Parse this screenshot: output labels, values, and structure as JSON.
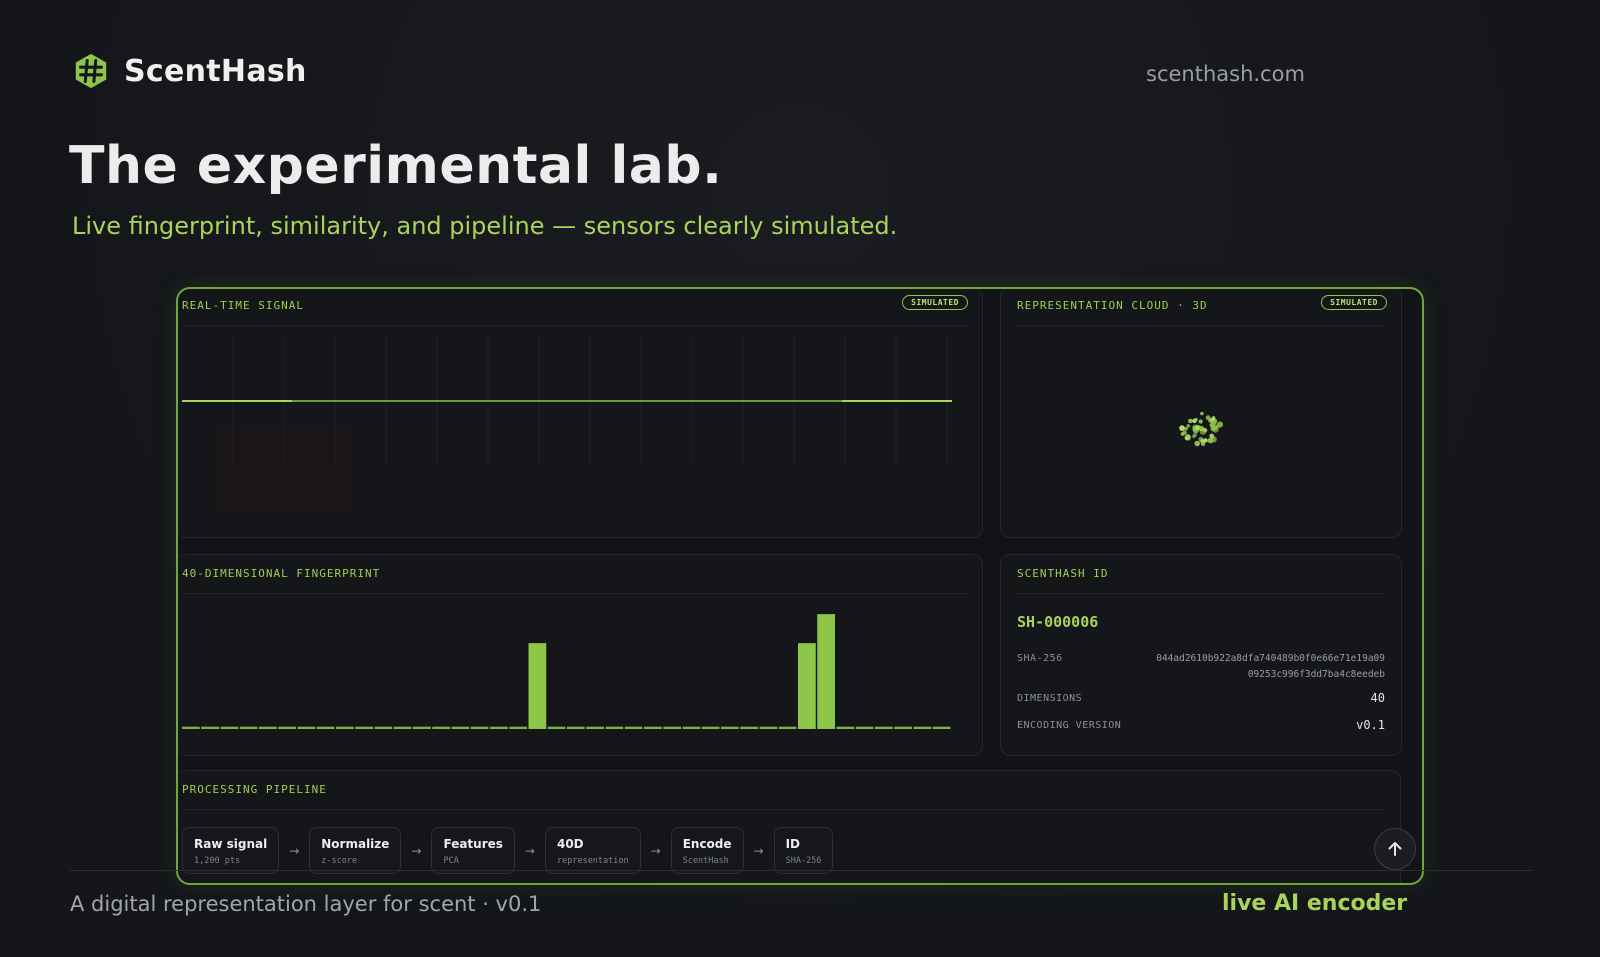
{
  "header": {
    "brand_name": "ScentHash",
    "logo_icon": "hash-hexagon-icon",
    "site_url": "scenthash.com"
  },
  "hero": {
    "title": "The experimental lab.",
    "subtitle": "Live fingerprint, similarity, and pipeline — sensors clearly simulated."
  },
  "theme": {
    "accent": "#a9d45a",
    "border": "#6fa83a",
    "background": "#141619"
  },
  "lab": {
    "signal_panel": {
      "title": "REAL-TIME SIGNAL",
      "badge": "SIMULATED"
    },
    "cloud_panel": {
      "title": "REPRESENTATION CLOUD · 3D",
      "badge": "SIMULATED"
    },
    "fingerprint_panel": {
      "title": "40-DIMENSIONAL FINGERPRINT",
      "values": [
        0.02,
        0.02,
        0.02,
        0.02,
        0.02,
        0.02,
        0.02,
        0.02,
        0.02,
        0.02,
        0.02,
        0.02,
        0.02,
        0.02,
        0.02,
        0.02,
        0.02,
        0.02,
        0.74,
        0.02,
        0.02,
        0.02,
        0.02,
        0.02,
        0.02,
        0.02,
        0.02,
        0.02,
        0.02,
        0.02,
        0.02,
        0.02,
        0.74,
        0.99,
        0.02,
        0.02,
        0.02,
        0.02,
        0.02,
        0.02
      ]
    },
    "id_panel": {
      "title": "SCENTHASH ID",
      "id": "SH-000006",
      "sha_label": "SHA-256",
      "sha_value": "044ad2610b922a8dfa740489b0f0e66e71e19a0909253c996f3dd7ba4c8eedeb",
      "dimensions_label": "DIMENSIONS",
      "dimensions_value": "40",
      "encoding_label": "ENCODING VERSION",
      "encoding_value": "v0.1"
    },
    "pipeline_panel": {
      "title": "PROCESSING PIPELINE",
      "steps": [
        {
          "label": "Raw signal",
          "sub": "1,200 pts"
        },
        {
          "label": "Normalize",
          "sub": "z-score"
        },
        {
          "label": "Features",
          "sub": "PCA"
        },
        {
          "label": "40D",
          "sub": "representation"
        },
        {
          "label": "Encode",
          "sub": "ScentHash"
        },
        {
          "label": "ID",
          "sub": "SHA-256"
        }
      ],
      "arrow": "→"
    }
  },
  "scroll_top_icon": "arrow-up-icon",
  "footer": {
    "tagline": "A digital representation layer for scent · v0.1",
    "status": "live AI encoder"
  }
}
